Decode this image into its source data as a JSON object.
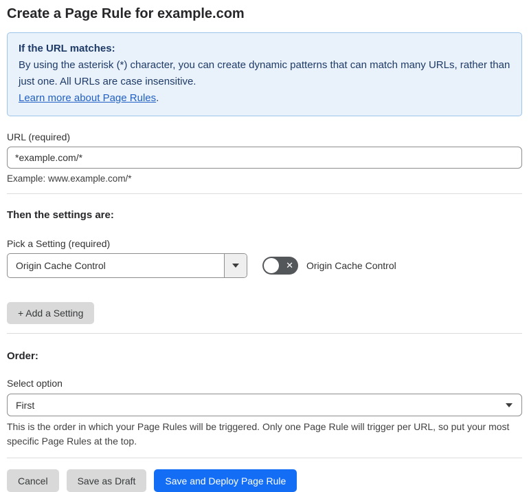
{
  "page": {
    "title": "Create a Page Rule for example.com"
  },
  "info_box": {
    "heading": "If the URL matches:",
    "body": "By using the asterisk (*) character, you can create dynamic patterns that can match many URLs, rather than just one. All URLs are case insensitive.",
    "link_label": "Learn more about Page Rules",
    "link_suffix": "."
  },
  "url_section": {
    "label": "URL (required)",
    "value": "*example.com/*",
    "example": "Example: www.example.com/*"
  },
  "settings_section": {
    "heading": "Then the settings are:",
    "picker_label": "Pick a Setting (required)",
    "picker_value": "Origin Cache Control",
    "toggle_label": "Origin Cache Control",
    "toggle_state": "off",
    "add_setting_label": "+ Add a Setting"
  },
  "order_section": {
    "heading": "Order:",
    "select_label": "Select option",
    "select_value": "First",
    "description": "This is the order in which your Page Rules will be triggered. Only one Page Rule will trigger per URL, so put your most specific Page Rules at the top."
  },
  "footer": {
    "cancel_label": "Cancel",
    "save_draft_label": "Save as Draft",
    "save_deploy_label": "Save and Deploy Page Rule"
  },
  "icons": {
    "toggle_off_x": "✕"
  },
  "colors": {
    "accent_blue": "#146ef5",
    "info_bg": "#e9f2fb",
    "info_border": "#9dc4ea",
    "info_text": "#1e3a66",
    "link_blue": "#2160c4",
    "toggle_off_bg": "#54575a",
    "button_gray": "#d9d9d9"
  }
}
